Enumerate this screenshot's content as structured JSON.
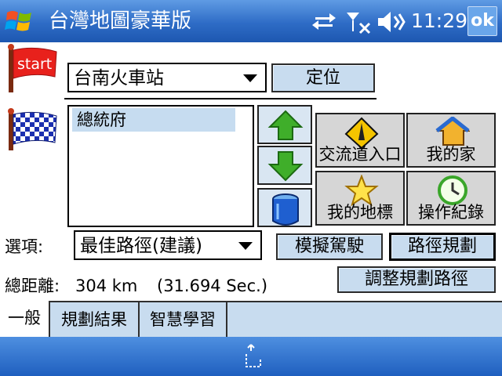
{
  "titlebar": {
    "title": "台灣地圖豪華版",
    "time": "11:29",
    "ok_label": "ok",
    "icons": [
      "windows-logo-icon",
      "connectivity-arrows-icon",
      "signal-off-icon",
      "speaker-icon"
    ]
  },
  "start": {
    "flag_text": "start",
    "location": "台南火車站",
    "locate_label": "定位"
  },
  "destination": {
    "items": [
      "總統府"
    ]
  },
  "actions": {
    "interchange_label": "交流道入口",
    "home_label": "我的家",
    "landmark_label": "我的地標",
    "log_label": "操作紀錄"
  },
  "options": {
    "label": "選項:",
    "route_option": "最佳路徑(建議)",
    "simulate_label": "模擬駕駛",
    "plan_label": "路徑規劃"
  },
  "summary": {
    "distance_label": "總距離:",
    "distance_value": "304 km",
    "time_value": "(31.694 Sec.)",
    "adjust_label": "調整規劃路徑"
  },
  "tabs": [
    "一般",
    "規劃結果",
    "智慧學習"
  ],
  "colors": {
    "titlebar": "#2e6cc6",
    "button_face": "#c8dcef",
    "selection": "#c6dcf0",
    "accent_green": "#3fae2a"
  }
}
